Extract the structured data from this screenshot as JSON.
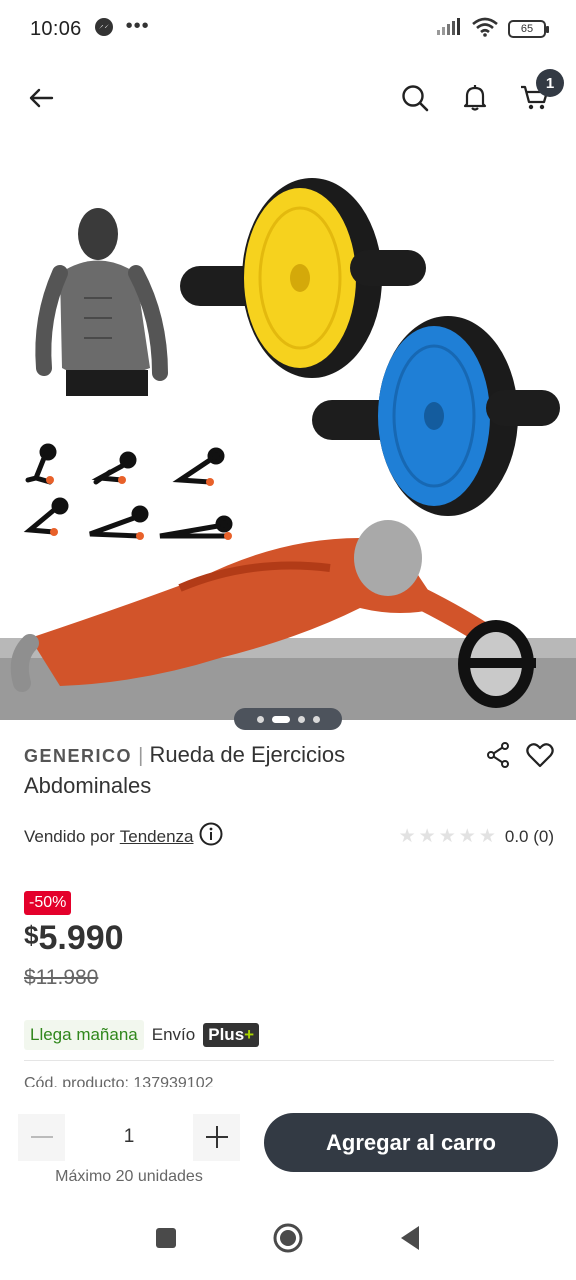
{
  "status_bar": {
    "time": "10:06",
    "dots": "•••",
    "battery": "65"
  },
  "nav": {
    "back_icon": "arrow-left-icon",
    "cart_count": "1"
  },
  "carousel": {
    "slides": 4,
    "active_index": 1
  },
  "product": {
    "brand": "GENERICO",
    "separator": "|",
    "name": "Rueda de Ejercicios Abdominales",
    "seller_prefix": "Vendido por",
    "seller": "Tendenza",
    "rating_text": "0.0 (0)",
    "discount": "-50%",
    "currency": "$",
    "price": "5.990",
    "old_price": "$11.980",
    "delivery": "Llega mañana",
    "shipping": "Envío",
    "plus_label": "Plus",
    "plus_sign": "+",
    "code_text": "Cód. producto: 137939102"
  },
  "purchase": {
    "qty": "1",
    "max_text": "Máximo 20 unidades",
    "add_label": "Agregar al carro"
  },
  "colors": {
    "accent_dark": "#333a44",
    "discount_red": "#e4002b",
    "delivery_green": "#30871c",
    "wheel_yellow": "#f6d21e",
    "wheel_blue": "#1f7fd6"
  }
}
